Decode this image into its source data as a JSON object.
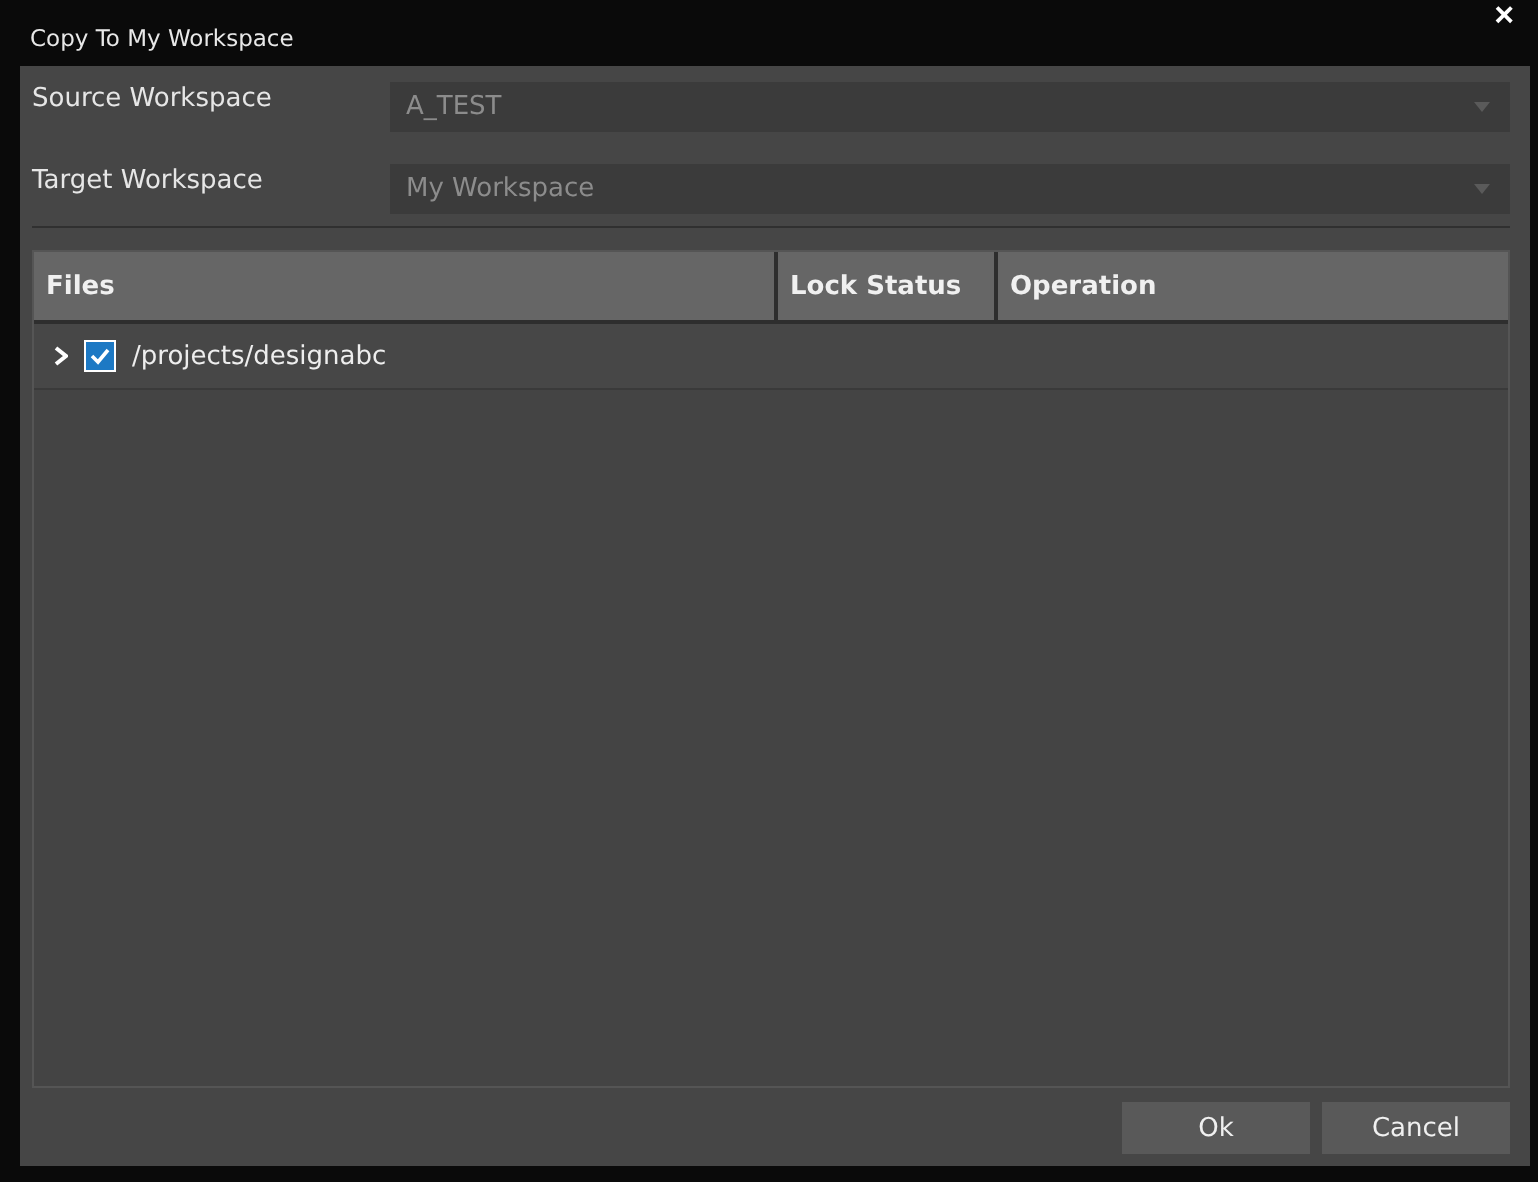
{
  "window": {
    "title": "Copy To My Workspace",
    "close": "×"
  },
  "fields": [
    {
      "label": "Source Workspace",
      "value": "A_TEST"
    },
    {
      "label": "Target Workspace",
      "value": "My Workspace"
    }
  ],
  "table": {
    "columns": [
      "Files",
      "Lock Status",
      "Operation"
    ],
    "rows": [
      {
        "expanded": false,
        "checked": true,
        "files": "/projects/designabc"
      }
    ]
  },
  "buttons": [
    "Ok",
    "Cancel"
  ]
}
